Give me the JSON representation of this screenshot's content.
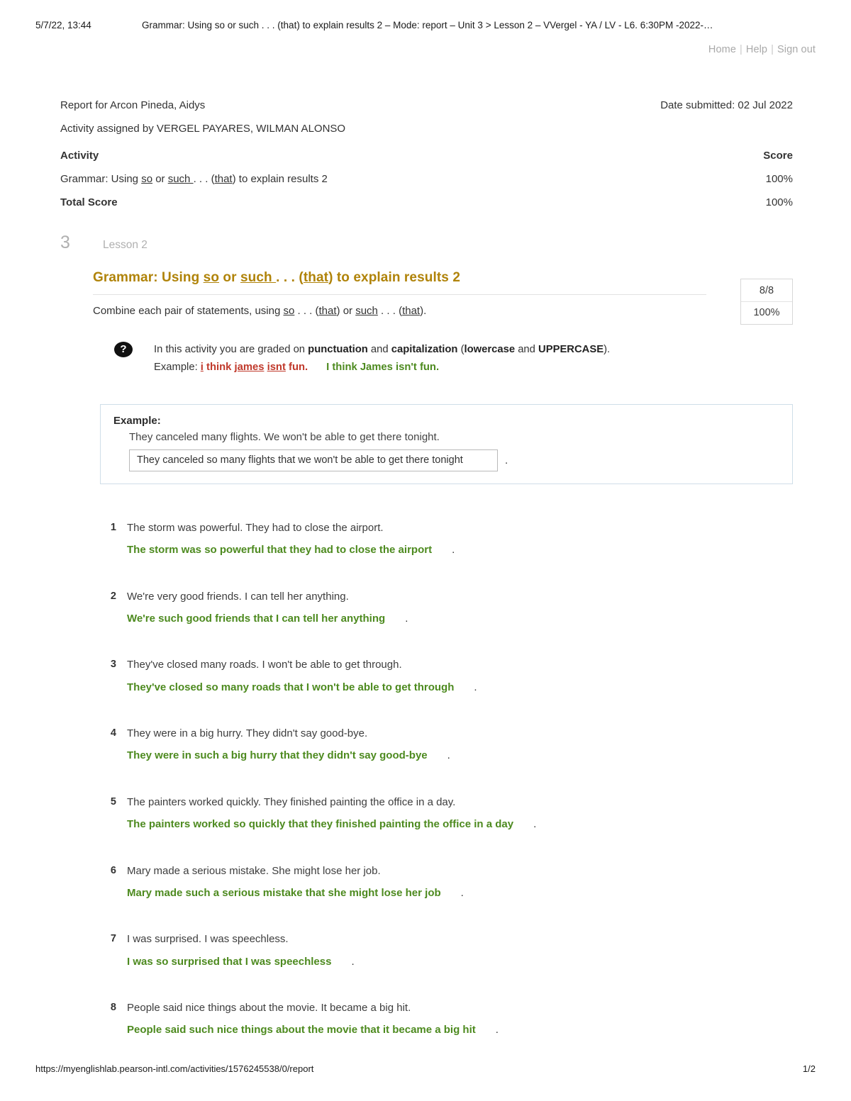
{
  "print_header": {
    "date": "5/7/22, 13:44",
    "title": "Grammar: Using so or such . . . (that) to explain results 2 – Mode: report – Unit 3 > Lesson 2 – VVergel - YA / LV - L6. 6:30PM -2022-…"
  },
  "topnav": {
    "home": "Home",
    "separator": "|",
    "help": "Help",
    "signout": "Sign out"
  },
  "report": {
    "for_label": "Report for Arcon Pineda, Aidys",
    "date_submitted": "Date submitted: 02 Jul 2022",
    "assigned_by": "Activity assigned by VERGEL PAYARES, WILMAN ALONSO",
    "table": {
      "col_activity": "Activity",
      "col_score": "Score",
      "activity_name_prefix": "Grammar: Using ",
      "activity_name_so": "so",
      "activity_name_mid": " or ",
      "activity_name_such": "such ",
      "activity_name_dots": ". . . (",
      "activity_name_that": "that",
      "activity_name_suffix": ") to explain results 2",
      "activity_score": "100%",
      "total_label": "Total Score",
      "total_score": "100%"
    }
  },
  "lesson": {
    "number": "3",
    "name": "Lesson 2"
  },
  "activity": {
    "title_prefix": "Grammar: Using ",
    "title_so": "so",
    "title_mid": " or ",
    "title_such": "such ",
    "title_dots": ". . . (",
    "title_that": "that",
    "title_suffix": ") to explain results 2",
    "instruction_prefix": "Combine each pair of statements, using ",
    "instruction_so": "so",
    "instruction_dots1": " . . . (",
    "instruction_that1": "that",
    "instruction_mid": ") or ",
    "instruction_such": "such",
    "instruction_dots2": " . . . (",
    "instruction_that2": "that",
    "instruction_suffix": ").",
    "score_fraction": "8/8",
    "score_percent": "100%"
  },
  "grading_note": {
    "icon": "question-mark-icon",
    "line1_a": "In this activity you are graded on ",
    "line1_punct": "punctuation",
    "line1_b": " and ",
    "line1_cap": "capitalization",
    "line1_c": " (",
    "line1_lower": "lowercase",
    "line1_d": " and ",
    "line1_upper": "UPPERCASE",
    "line1_e": ").",
    "example_label": "Example: ",
    "bad_i": "i",
    "bad_think": " think ",
    "bad_james": "james",
    "bad_space": " ",
    "bad_isnt": "isnt",
    "bad_fun": " fun.",
    "good_text": "I think James isn't fun."
  },
  "example_box": {
    "label": "Example:",
    "prompt": "They canceled many flights. We won't be able to get there tonight.",
    "answer_value": "They canceled so many flights that we won't be able to get there tonight",
    "period": "."
  },
  "questions": [
    {
      "number": "1",
      "prompt": "The storm was powerful. They had to close the airport.",
      "answer": "The storm was so powerful that they had to close the airport",
      "period": "."
    },
    {
      "number": "2",
      "prompt": "We're very good friends. I can tell her anything.",
      "answer": "We're such good friends that I can tell her anything",
      "period": "."
    },
    {
      "number": "3",
      "prompt": "They've closed many roads. I won't be able to get through.",
      "answer": "They've closed so many roads that I won't be able to get through",
      "period": "."
    },
    {
      "number": "4",
      "prompt": "They were in a big hurry. They didn't say good-bye.",
      "answer": "They were in such a big hurry that they didn't say good-bye",
      "period": "."
    },
    {
      "number": "5",
      "prompt": "The painters worked quickly. They finished painting the office in a day.",
      "answer": "The painters worked so quickly that they finished painting the office in a day",
      "period": "."
    },
    {
      "number": "6",
      "prompt": "Mary made a serious mistake. She might lose her job.",
      "answer": "Mary made such a serious mistake that she might lose her job",
      "period": "."
    },
    {
      "number": "7",
      "prompt": "I was surprised. I was speechless.",
      "answer": "I was so surprised that I was speechless",
      "period": "."
    },
    {
      "number": "8",
      "prompt": "People said nice things about the movie. It became a big hit.",
      "answer": "People said such nice things about the movie that it became a big hit",
      "period": "."
    }
  ],
  "footer": {
    "url": "https://myenglishlab.pearson-intl.com/activities/1576245538/0/report",
    "page": "1/2"
  },
  "colors": {
    "title_gold": "#b08309",
    "answer_green": "#4d8a1f",
    "error_red": "#c0392b",
    "muted_gray": "#b0b0b0",
    "example_border": "#cfdee8"
  }
}
